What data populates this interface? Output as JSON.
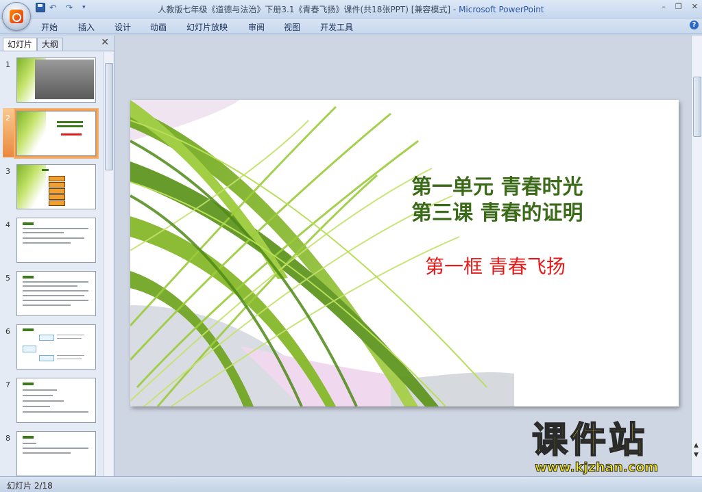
{
  "window": {
    "title_doc": "人教版七年级《道德与法治》下册3.1《青春飞扬》课件(共18张PPT) [兼容模式] - ",
    "title_app": "Microsoft PowerPoint",
    "minimize": "–",
    "restore": "❐",
    "close": "✕"
  },
  "qat": {
    "undo": "↶",
    "redo": "↷",
    "more": "▾"
  },
  "ribbon": {
    "tabs": [
      "开始",
      "插入",
      "设计",
      "动画",
      "幻灯片放映",
      "审阅",
      "视图",
      "开发工具"
    ],
    "help": "?"
  },
  "panel": {
    "tab_slides": "幻灯片",
    "tab_outline": "大纲",
    "close": "✕",
    "thumbnails": [
      "1",
      "2",
      "3",
      "4",
      "5",
      "6",
      "7",
      "8"
    ],
    "selected": 2
  },
  "slide": {
    "line1": "第一单元 青春时光",
    "line2": "第三课 青春的证明",
    "line3": "第一框 青春飞扬"
  },
  "status": {
    "slide_indicator": "幻灯片 2/18"
  },
  "watermark": {
    "main": "课件站",
    "url": "www.kjzhan.com"
  },
  "colors": {
    "title_green": "#3b6b18",
    "subtitle_red": "#e21b1b",
    "selection": "#f2b072"
  }
}
